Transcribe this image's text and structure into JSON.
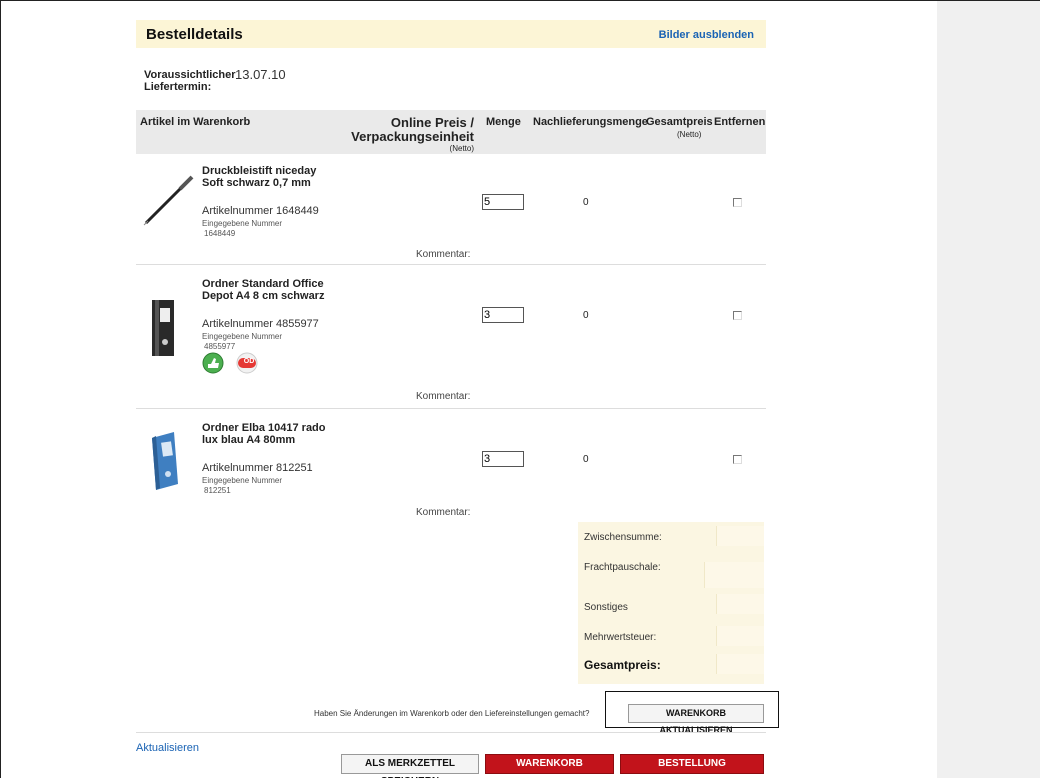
{
  "header": {
    "title": "Bestelldetails",
    "hide_images_link": "Bilder ausblenden"
  },
  "delivery": {
    "label_line1": "Voraussichtlicher",
    "label_line2": "Liefertermin:",
    "date": "13.07.10"
  },
  "table_headers": {
    "artikel": "Artikel im Warenkorb",
    "preis_line1": "Online Preis /",
    "preis_line2": "Verpackungseinheit",
    "preis_sub": "(Netto)",
    "menge": "Menge",
    "nachlieferung": "Nachlieferungsmenge",
    "gesamt": "Gesamtpreis",
    "gesamt_sub": "(Netto)",
    "entfernen": "Entfernen"
  },
  "items": [
    {
      "name": "Druckbleistift niceday Soft schwarz 0,7 mm",
      "artnum_label": "Artikelnummer",
      "artnum": "1648449",
      "entered_label": "Eingegebene Nummer",
      "entered_value": "1648449",
      "qty": "5",
      "nach": "0",
      "comment": "Kommentar:"
    },
    {
      "name": "Ordner Standard Office Depot A4 8 cm schwarz",
      "artnum_label": "Artikelnummer",
      "artnum": "4855977",
      "entered_label": "Eingegebene Nummer",
      "entered_value": "4855977",
      "qty": "3",
      "nach": "0",
      "comment": "Kommentar:",
      "badge_od": "OD"
    },
    {
      "name": "Ordner Elba 10417 rado lux blau A4 80mm",
      "artnum_label": "Artikelnummer",
      "artnum": "812251",
      "entered_label": "Eingegebene Nummer",
      "entered_value": "812251",
      "qty": "3",
      "nach": "0",
      "comment": "Kommentar:"
    }
  ],
  "summary": {
    "zwischensumme": "Zwischensumme:",
    "fracht": "Frachtpauschale:",
    "sonstiges": "Sonstiges",
    "mwst": "Mehrwertsteuer:",
    "gesamt": "Gesamtpreis:"
  },
  "footer": {
    "question": "Haben Sie Änderungen im Warenkorb oder den Liefereinstellungen gemacht?",
    "update_button": "WARENKORB AKTUALISIEREN",
    "refresh_link": "Aktualisieren",
    "save_list_button": "ALS MERKZETTEL SPEICHERN",
    "save_cart_button": "WARENKORB SPEICHERN",
    "forward_button": "BESTELLUNG WEITERLEITEN"
  },
  "colors": {
    "accent_red": "#c2131b",
    "link_blue": "#1a63b4",
    "header_bg": "#fcf5d6"
  }
}
